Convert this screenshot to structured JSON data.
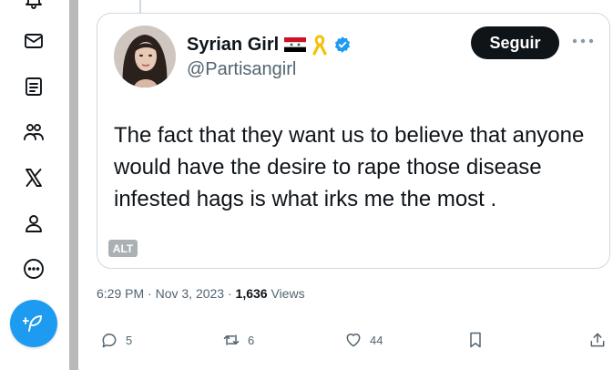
{
  "sidebar": {
    "items": [
      {
        "icon": "bell-icon"
      },
      {
        "icon": "mail-icon"
      },
      {
        "icon": "lists-icon"
      },
      {
        "icon": "communities-icon"
      },
      {
        "icon": "x-logo-icon"
      },
      {
        "icon": "profile-icon"
      },
      {
        "icon": "more-circle-icon"
      }
    ],
    "compose_icon": "feather-icon",
    "accent": "#1d9bf0"
  },
  "embedded_post": {
    "display_name": "Syrian Girl",
    "emoji": [
      "syria-flag-icon",
      "yellow-ribbon-icon",
      "verified-badge-icon"
    ],
    "handle": "@Partisangirl",
    "follow_label": "Seguir",
    "text": "The fact that they want us to believe that anyone would have the desire to rape those disease infested hags is what irks me the most .",
    "alt_badge": "ALT"
  },
  "meta": {
    "time": "6:29 PM",
    "sep1": " · ",
    "date": "Nov 3, 2023",
    "sep2": " · ",
    "views_count": "1,636",
    "views_label": " Views"
  },
  "actions": {
    "replies": "5",
    "reposts": "6",
    "likes": "44"
  },
  "colors": {
    "text": "#0f1419",
    "secondary": "#536471",
    "border": "#cfd9de",
    "verified": "#1d9bf0"
  }
}
